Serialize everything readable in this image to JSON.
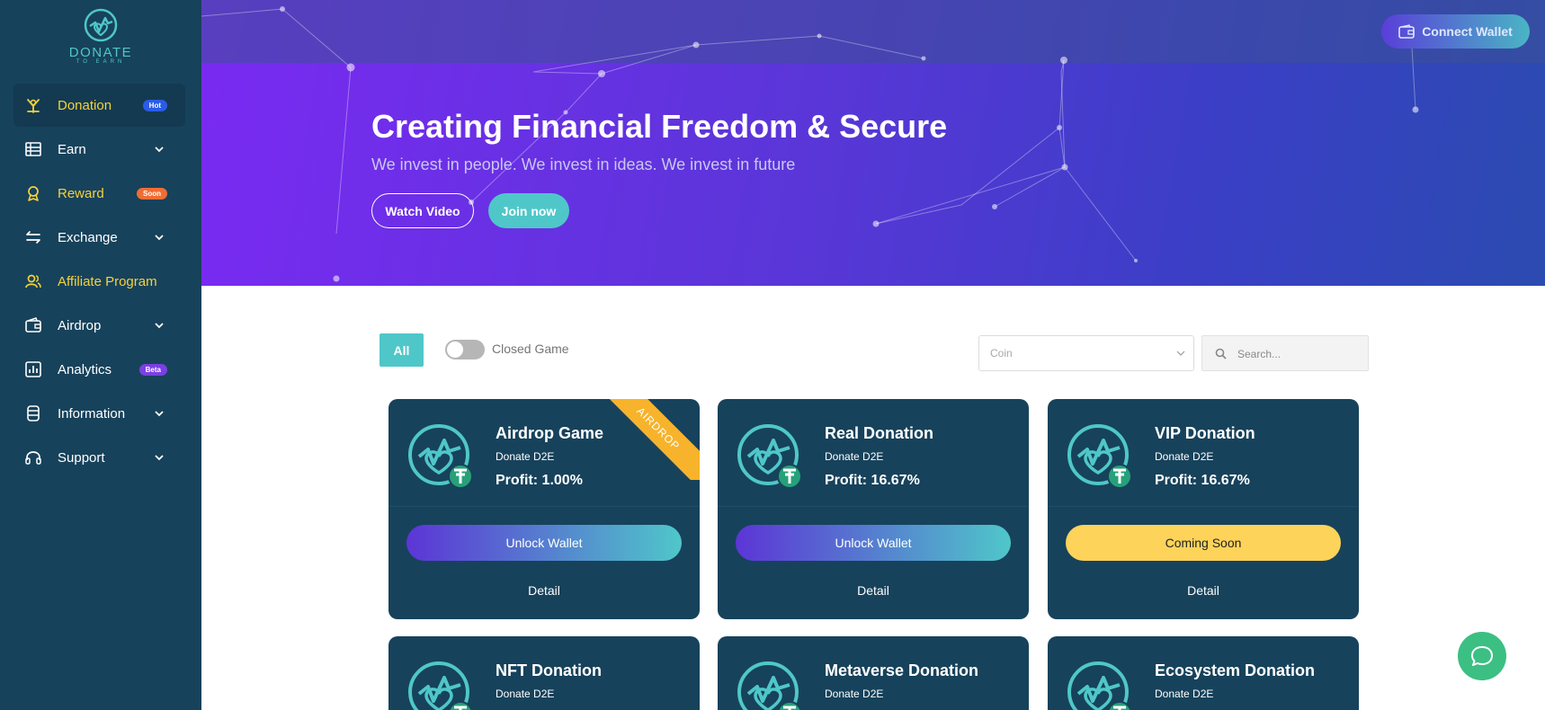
{
  "brand": {
    "logo_text": "DONATE",
    "logo_subtext": "TO EARN"
  },
  "sidebar": {
    "items": [
      {
        "label": "Donation",
        "icon": "donation-icon",
        "badge": "Hot"
      },
      {
        "label": "Earn",
        "icon": "earn-icon"
      },
      {
        "label": "Reward",
        "icon": "reward-icon",
        "badge": "Soon"
      },
      {
        "label": "Exchange",
        "icon": "exchange-icon"
      },
      {
        "label": "Affiliate Program",
        "icon": "affiliate-icon"
      },
      {
        "label": "Airdrop",
        "icon": "airdrop-wallet-icon"
      },
      {
        "label": "Analytics",
        "icon": "analytics-icon",
        "badge": "Beta"
      },
      {
        "label": "Information",
        "icon": "information-icon"
      },
      {
        "label": "Support",
        "icon": "headset-icon"
      }
    ]
  },
  "header": {
    "connect_label": "Connect Wallet"
  },
  "hero": {
    "title": "Creating Financial Freedom & Secure",
    "subtitle": "We invest in people. We invest in ideas. We invest in future",
    "watch_label": "Watch Video",
    "join_label": "Join now"
  },
  "filters": {
    "all_label": "All",
    "toggle_label": "Closed Game",
    "coin_placeholder": "Coin",
    "search_placeholder": "Search..."
  },
  "cards": [
    {
      "title": "Airdrop Game",
      "sub": "Donate D2E",
      "profit": "Profit: 1.00%",
      "action": "Unlock Wallet",
      "detail": "Detail",
      "ribbon": "AIRDROP"
    },
    {
      "title": "Real Donation",
      "sub": "Donate D2E",
      "profit": "Profit: 16.67%",
      "action": "Unlock Wallet",
      "detail": "Detail"
    },
    {
      "title": "VIP Donation",
      "sub": "Donate D2E",
      "profit": "Profit: 16.67%",
      "action": "Coming Soon",
      "detail": "Detail"
    },
    {
      "title": "NFT Donation",
      "sub": "Donate D2E"
    },
    {
      "title": "Metaverse Donation",
      "sub": "Donate D2E"
    },
    {
      "title": "Ecosystem Donation",
      "sub": "Donate D2E"
    }
  ],
  "colors": {
    "sidebar": "#17425b",
    "accent_teal": "#4fc7c9",
    "highlight_yellow": "#f5d23a",
    "chat_green": "#3cbf83"
  }
}
